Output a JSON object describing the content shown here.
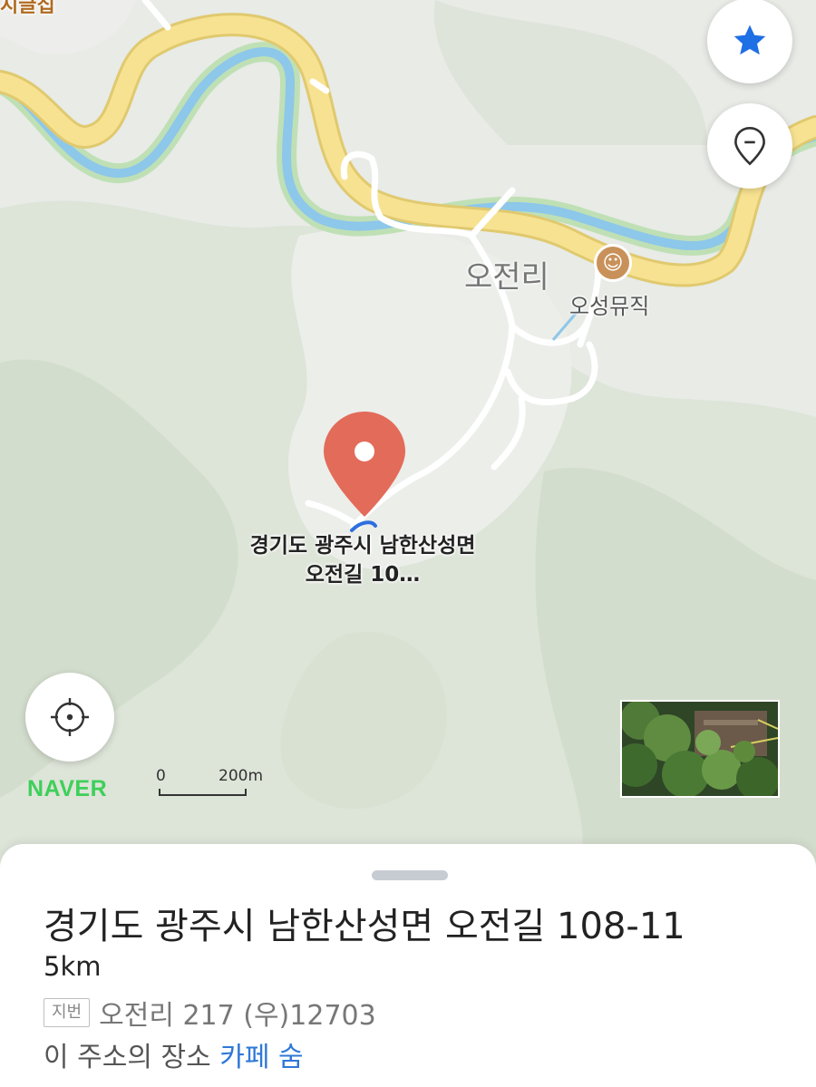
{
  "map": {
    "top_place_label": "지글집",
    "village_label": "오전리",
    "poi": {
      "label": "오성뮤직",
      "icon": "theater-mask-icon"
    },
    "pin": {
      "line1": "경기도 광주시 남한산성면",
      "line2": "오전길 10…"
    },
    "brand": "NAVER",
    "scale": {
      "zero": "0",
      "distance": "200m"
    },
    "colors": {
      "road_main": "#f7e291",
      "river": "#8dc7ea",
      "pin": "#e36b5a",
      "brand": "#3ecf59",
      "accent": "#1f6fe5"
    }
  },
  "controls": {
    "favorite_icon": "star-icon",
    "place_icon": "location-pin-outline-icon",
    "my_location_icon": "crosshair-icon"
  },
  "sheet": {
    "title": "경기도 광주시 남한산성면 오전길 108-11",
    "distance": "5km",
    "jibun_badge": "지번",
    "jibun_text": "오전리 217 (우)12703",
    "place_prefix": "이 주소의 장소",
    "place_link": "카페 숨"
  }
}
